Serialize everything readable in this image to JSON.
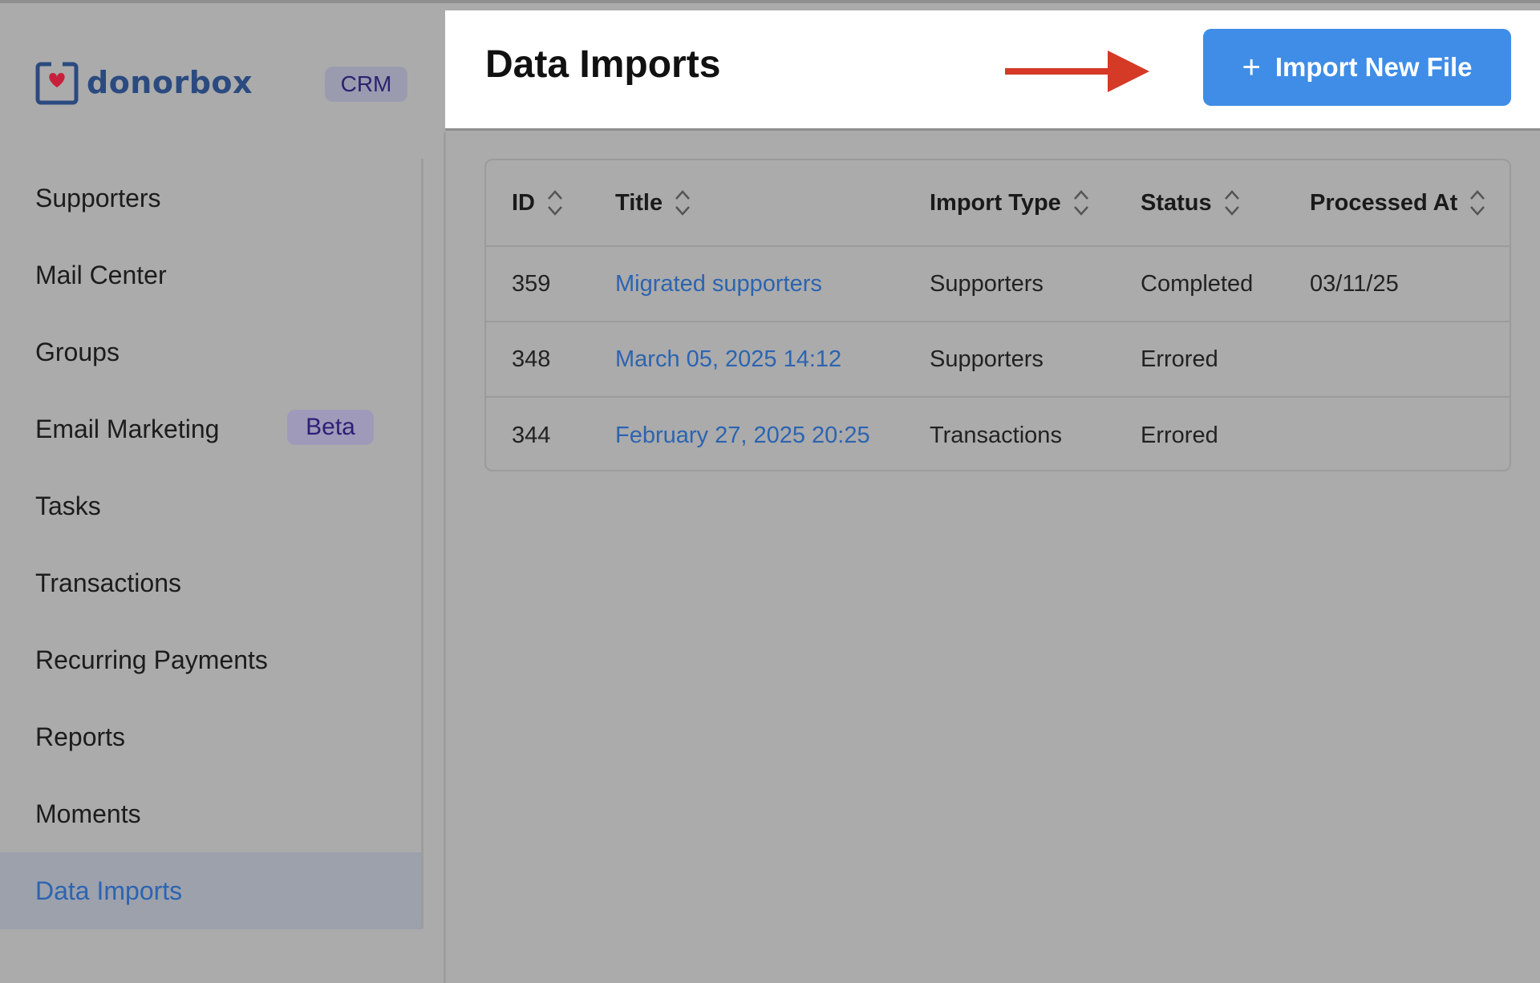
{
  "sidebar": {
    "logo_text": "donorbox",
    "crm_badge": "CRM",
    "items": [
      {
        "label": "Supporters"
      },
      {
        "label": "Mail Center"
      },
      {
        "label": "Groups"
      },
      {
        "label": "Email Marketing",
        "badge": "Beta"
      },
      {
        "label": "Tasks"
      },
      {
        "label": "Transactions"
      },
      {
        "label": "Recurring Payments"
      },
      {
        "label": "Reports"
      },
      {
        "label": "Moments"
      },
      {
        "label": "Data Imports",
        "active": true
      }
    ]
  },
  "header": {
    "title": "Data Imports",
    "import_button_label": "Import New File"
  },
  "table": {
    "columns": [
      "ID",
      "Title",
      "Import Type",
      "Status",
      "Processed At"
    ],
    "rows": [
      {
        "id": "359",
        "title": "Migrated supporters",
        "import_type": "Supporters",
        "status": "Completed",
        "processed_at": "03/11/25"
      },
      {
        "id": "348",
        "title": "March 05, 2025 14:12",
        "import_type": "Supporters",
        "status": "Errored",
        "processed_at": ""
      },
      {
        "id": "344",
        "title": "February 27, 2025 20:25",
        "import_type": "Transactions",
        "status": "Errored",
        "processed_at": ""
      }
    ]
  },
  "colors": {
    "accent": "#3f8de6",
    "link": "#2c64b1",
    "arrow": "#d43a26",
    "logo": "#2b4a80",
    "heart": "#c8203c"
  },
  "icons": {
    "logo": "donorbox-heart-icon",
    "sort": "sort-updown-icon",
    "plus": "plus-icon",
    "arrow": "arrow-right-icon"
  }
}
